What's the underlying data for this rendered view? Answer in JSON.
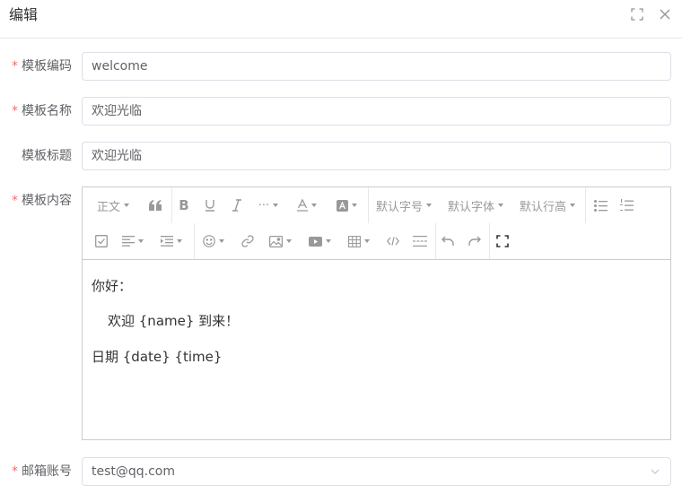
{
  "dialog": {
    "title": "编辑",
    "icons": {
      "maximize": "fullscreen-icon",
      "close": "close-icon"
    }
  },
  "form": {
    "code": {
      "label": "模板编码",
      "required": true,
      "value": "welcome"
    },
    "name": {
      "label": "模板名称",
      "required": true,
      "value": "欢迎光临"
    },
    "title": {
      "label": "模板标题",
      "required": false,
      "value": "欢迎光临"
    },
    "content": {
      "label": "模板内容",
      "required": true
    },
    "account": {
      "label": "邮箱账号",
      "required": true,
      "value": "test@qq.com"
    }
  },
  "editor": {
    "toolbar": {
      "heading": "正文",
      "font_size": "默认字号",
      "font_family": "默认字体",
      "line_height": "默认行高",
      "more": "···"
    },
    "content": {
      "line1": "你好：",
      "line2": "欢迎 {name} 到来！",
      "line3": "日期 {date} {time}"
    }
  },
  "colors": {
    "required": "#f56c6c",
    "border": "#dcdfe6",
    "icon": "#999999"
  }
}
